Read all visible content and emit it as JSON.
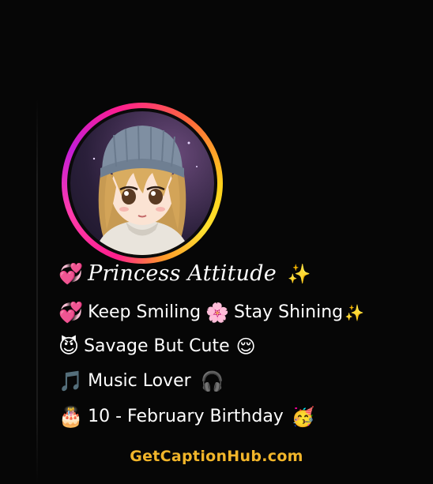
{
  "profile": {
    "avatar_desc_icon": "anime-girl-avatar",
    "ring_colors": [
      "#ff1f8e",
      "#c41dd6",
      "#ffd21a",
      "#ff9a2a"
    ]
  },
  "bio": {
    "title": {
      "emoji_before": "💞",
      "text": "Princess Attitude",
      "emoji_after": "✨"
    },
    "lines": [
      {
        "emoji_before": "💞",
        "text": "Keep Smiling",
        "emoji_mid": "🌸",
        "text2": "Stay Shining",
        "emoji_after": "✨"
      },
      {
        "emoji_before": "😈",
        "text": "Savage But Cute",
        "emoji_after": "😌"
      },
      {
        "emoji_before": "🎵",
        "text": "Music Lover",
        "emoji_after": "🎧"
      },
      {
        "emoji_before": "🎂",
        "text": "10 - February Birthday",
        "emoji_after": "🥳"
      }
    ]
  },
  "footer": {
    "credit": "GetCaptionHub.com",
    "credit_color": "#f1b52a"
  }
}
